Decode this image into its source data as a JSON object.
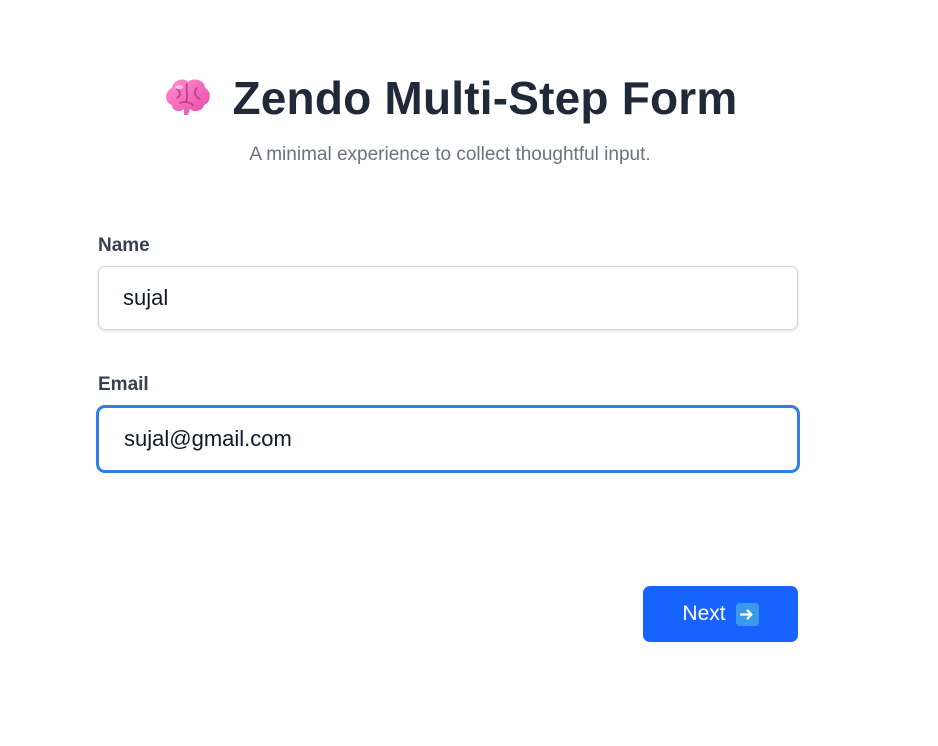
{
  "header": {
    "title": "Zendo Multi-Step Form",
    "subtitle": "A minimal experience to collect thoughtful input.",
    "icon": "brain-icon"
  },
  "form": {
    "name": {
      "label": "Name",
      "value": "sujal"
    },
    "email": {
      "label": "Email",
      "value": "sujal@gmail.com"
    },
    "next_button": {
      "label": "Next",
      "icon": "right-arrow-icon"
    }
  },
  "colors": {
    "accent": "#1763ff",
    "focus_ring": "#2f7fe8",
    "title": "#1f2937",
    "subtitle": "#6b7280"
  }
}
